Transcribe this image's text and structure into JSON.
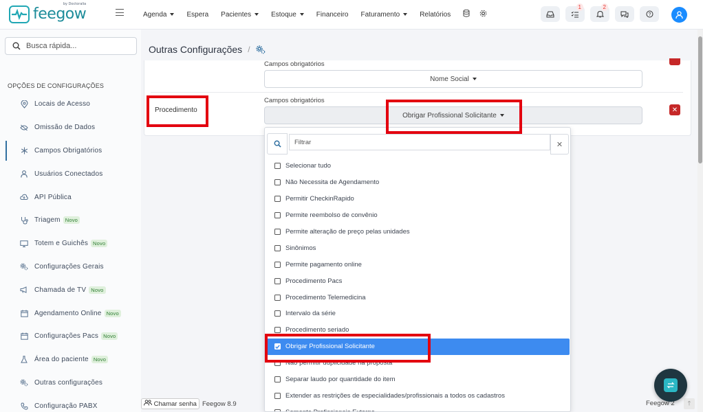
{
  "brand": {
    "name": "feegow",
    "by": "by Doctoralia"
  },
  "nav": [
    {
      "label": "Agenda",
      "caret": true
    },
    {
      "label": "Espera",
      "caret": false
    },
    {
      "label": "Pacientes",
      "caret": true
    },
    {
      "label": "Estoque",
      "caret": true
    },
    {
      "label": "Financeiro",
      "caret": false
    },
    {
      "label": "Faturamento",
      "caret": true
    },
    {
      "label": "Relatórios",
      "caret": false
    }
  ],
  "top_badges": {
    "tasks": "1",
    "notifications": "2"
  },
  "search": {
    "placeholder": "Busca rápida..."
  },
  "sidebar": {
    "heading": "OPÇÕES DE CONFIGURAÇÕES",
    "items": [
      {
        "label": "Locais de Acesso",
        "icon": "map-pin-icon",
        "novo": false
      },
      {
        "label": "Omissão de Dados",
        "icon": "eye-off-icon",
        "novo": false
      },
      {
        "label": "Campos Obrigatórios",
        "icon": "asterisk-icon",
        "novo": false,
        "active": true
      },
      {
        "label": "Usuários Conectados",
        "icon": "user-icon",
        "novo": false
      },
      {
        "label": "API Pública",
        "icon": "cloud-icon",
        "novo": false
      },
      {
        "label": "Triagem",
        "icon": "stethoscope-icon",
        "novo": true
      },
      {
        "label": "Totem e Guichês",
        "icon": "monitor-icon",
        "novo": true
      },
      {
        "label": "Configurações Gerais",
        "icon": "gears-icon",
        "novo": false
      },
      {
        "label": "Chamada de TV",
        "icon": "megaphone-icon",
        "novo": true
      },
      {
        "label": "Agendamento Online",
        "icon": "calendar-icon",
        "novo": true
      },
      {
        "label": "Configurações Pacs",
        "icon": "calendar-icon",
        "novo": true
      },
      {
        "label": "Área do paciente",
        "icon": "flask-icon",
        "novo": true
      },
      {
        "label": "Outras configurações",
        "icon": "gears-icon",
        "novo": false
      },
      {
        "label": "Configuração PABX",
        "icon": "phone-icon",
        "novo": false
      }
    ],
    "novo_label": "Novo"
  },
  "main": {
    "title": "Outras Configurações",
    "row1": {
      "fields_label": "Campos obrigatórios",
      "selected": "Nome Social"
    },
    "row2": {
      "entity": "Procedimento",
      "fields_label": "Campos obrigatórios",
      "selected": "Obrigar Profissional Solicitante"
    }
  },
  "dropdown": {
    "filter_placeholder": "Filtrar",
    "options": [
      {
        "label": "Selecionar tudo",
        "checked": false
      },
      {
        "label": "Não Necessita de Agendamento",
        "checked": false
      },
      {
        "label": "Permitir CheckinRapido",
        "checked": false
      },
      {
        "label": "Permite reembolso de convênio",
        "checked": false
      },
      {
        "label": "Permite alteração de preço pelas unidades",
        "checked": false
      },
      {
        "label": "Sinônimos",
        "checked": false
      },
      {
        "label": "Permite pagamento online",
        "checked": false
      },
      {
        "label": "Procedimento Pacs",
        "checked": false
      },
      {
        "label": "Procedimento Telemedicina",
        "checked": false
      },
      {
        "label": "Intervalo da série",
        "checked": false
      },
      {
        "label": "Procedimento seriado",
        "checked": false
      },
      {
        "label": "Obrigar Profissional Solicitante",
        "checked": true
      },
      {
        "label": "Não permitir duplicidade na proposta",
        "checked": false
      },
      {
        "label": "Separar laudo por quantidade do item",
        "checked": false
      },
      {
        "label": "Extender as restrições de especialidades/profissionais a todos os cadastros",
        "checked": false
      },
      {
        "label": "Somente Profissionais Externo",
        "checked": false
      }
    ]
  },
  "footer": {
    "chamar": "Chamar senha",
    "version": "Feegow 8.9",
    "right": "Feegow 2"
  },
  "colors": {
    "accent": "#1a8cff",
    "brand": "#20a7b4",
    "highlight": "#e3000f",
    "selected": "#3d8bf0"
  }
}
